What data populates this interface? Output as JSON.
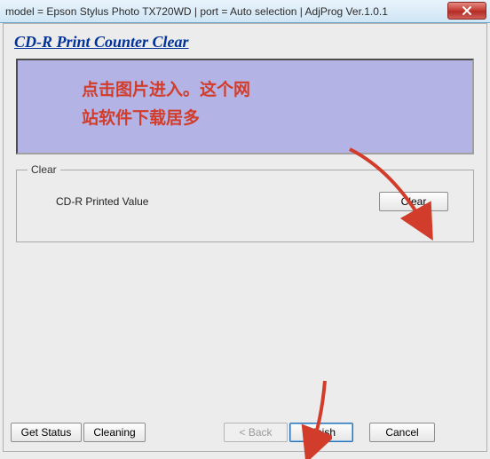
{
  "window": {
    "title": "model = Epson Stylus Photo TX720WD | port = Auto selection | AdjProg Ver.1.0.1"
  },
  "heading": "CD-R Print Counter Clear",
  "banner": {
    "line1": "点击图片进入。这个网",
    "line2": "站软件下载居多"
  },
  "group": {
    "legend": "Clear",
    "label": "CD-R Printed Value",
    "clear_btn": "Clear"
  },
  "buttons": {
    "get_status": "Get Status",
    "cleaning": "Cleaning",
    "back": "< Back",
    "finish": "Finish",
    "cancel": "Cancel"
  }
}
